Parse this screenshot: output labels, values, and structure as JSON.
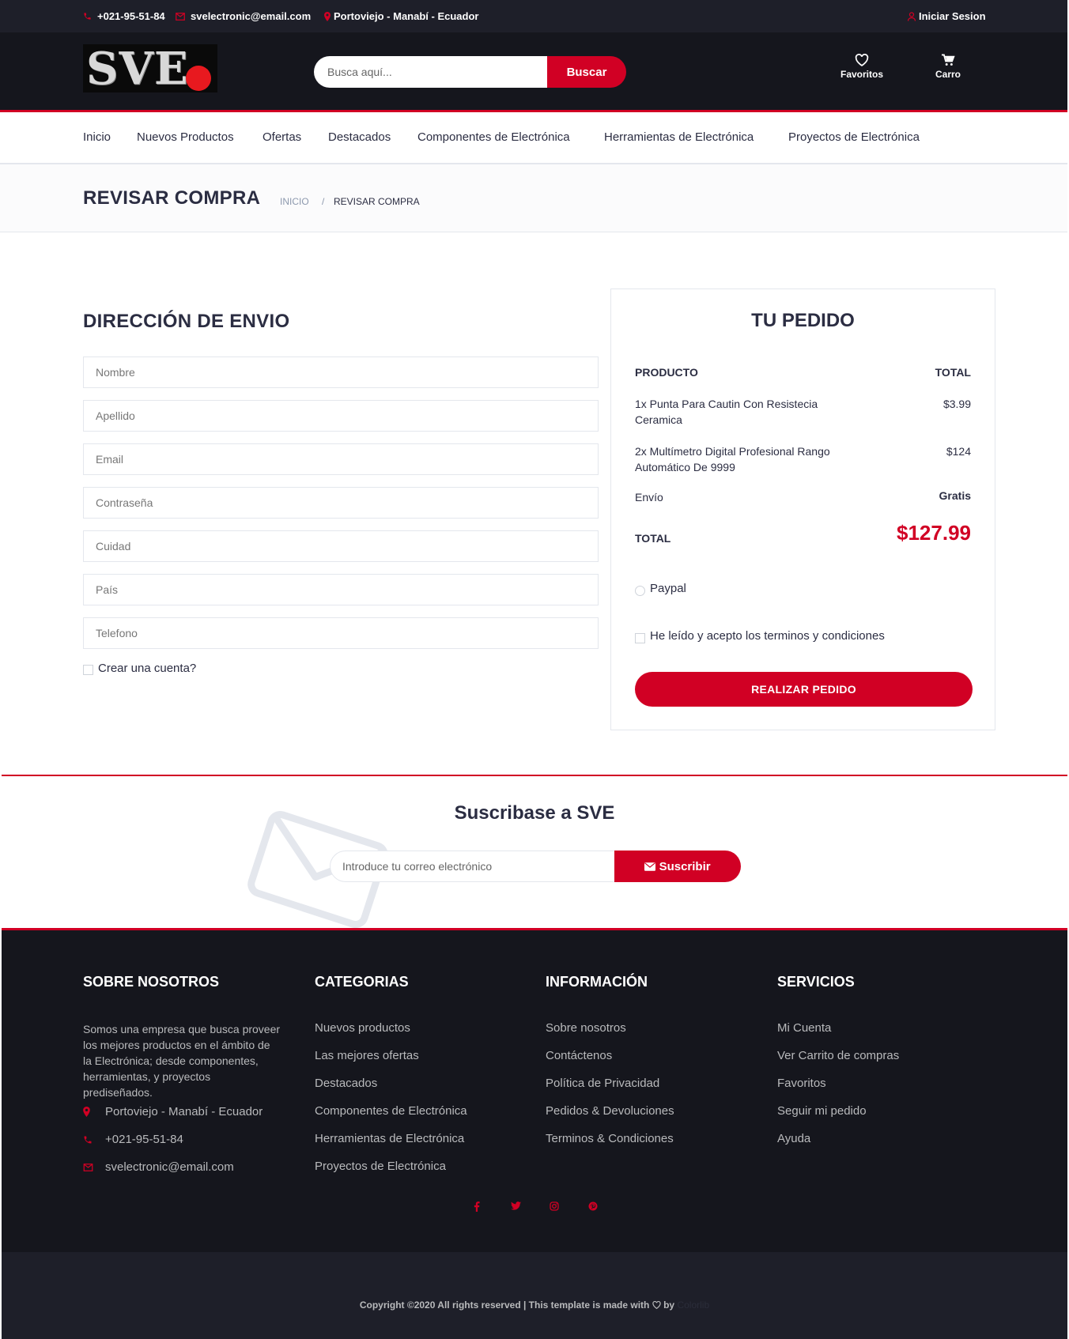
{
  "topbar": {
    "phone": "+021-95-51-84",
    "email": "svelectronic@email.com",
    "location": "Portoviejo - Manabí - Ecuador",
    "login": "Iniciar Sesion"
  },
  "header": {
    "logo_text": "SVE",
    "search_placeholder": "Busca aquí...",
    "search_button": "Buscar",
    "favorites_label": "Favoritos",
    "cart_label": "Carro"
  },
  "nav": {
    "items": [
      "Inicio",
      "Nuevos Productos",
      "Ofertas",
      "Destacados",
      "Componentes de Electrónica",
      "Herramientas de Electrónica",
      "Proyectos de Electrónica"
    ]
  },
  "breadcrumb": {
    "title": "REVISAR COMPRA",
    "home": "INICIO",
    "separator": "/",
    "current": "REVISAR COMPRA"
  },
  "shipping": {
    "title": "DIRECCIÓN DE ENVIO",
    "fields": [
      "Nombre",
      "Apellido",
      "Email",
      "Contraseña",
      "Cuidad",
      "País",
      "Telefono"
    ],
    "create_account": "Crear una cuenta?"
  },
  "order": {
    "title": "TU PEDIDO",
    "col_product": "PRODUCTO",
    "col_total": "TOTAL",
    "items": [
      {
        "name": "1x Punta Para Cautin Con Resistecia Ceramica",
        "price": "$3.99"
      },
      {
        "name": "2x Multímetro Digital Profesional Rango Automático De 9999",
        "price": "$124"
      }
    ],
    "shipping_label": "Envío",
    "shipping_value": "Gratis",
    "total_label": "TOTAL",
    "total_value": "$127.99",
    "payment_option": "Paypal",
    "terms_label": "He leído y acepto los terminos y condiciones",
    "submit": "REALIZAR PEDIDO"
  },
  "newsletter": {
    "title_prefix": "Suscribase a ",
    "title_brand": "SVE",
    "input_placeholder": "Introduce tu correo electrónico",
    "button": "Suscribir"
  },
  "footer": {
    "about": {
      "title": "SOBRE NOSOTROS",
      "text": "Somos una empresa que busca proveer los mejores productos en el ámbito de la Electrónica; desde componentes, herramientas, y proyectos prediseñados.",
      "location": "Portoviejo - Manabí - Ecuador",
      "phone": "+021-95-51-84",
      "email": "svelectronic@email.com"
    },
    "categories": {
      "title": "CATEGORIAS",
      "links": [
        "Nuevos productos",
        "Las mejores ofertas",
        "Destacados",
        "Componentes de Electrónica",
        "Herramientas de Electrónica",
        "Proyectos de Electrónica"
      ]
    },
    "info": {
      "title": "INFORMACIÓN",
      "links": [
        "Sobre nosotros",
        "Contáctenos",
        "Política de Privacidad",
        "Pedidos & Devoluciones",
        "Terminos & Condiciones"
      ]
    },
    "services": {
      "title": "SERVICIOS",
      "links": [
        "Mi Cuenta",
        "Ver Carrito de compras",
        "Favoritos",
        "Seguir mi pedido",
        "Ayuda"
      ]
    },
    "social_icons": [
      "facebook-icon",
      "twitter-icon",
      "instagram-icon",
      "pinterest-icon"
    ],
    "copyright": "Copyright ©2020 All rights reserved | This template is made with",
    "copyright_by": "by",
    "copyright_brand": "Colorlib"
  },
  "colors": {
    "accent": "#d10024",
    "dark": "#15161d",
    "topbar": "#1e1f29"
  }
}
